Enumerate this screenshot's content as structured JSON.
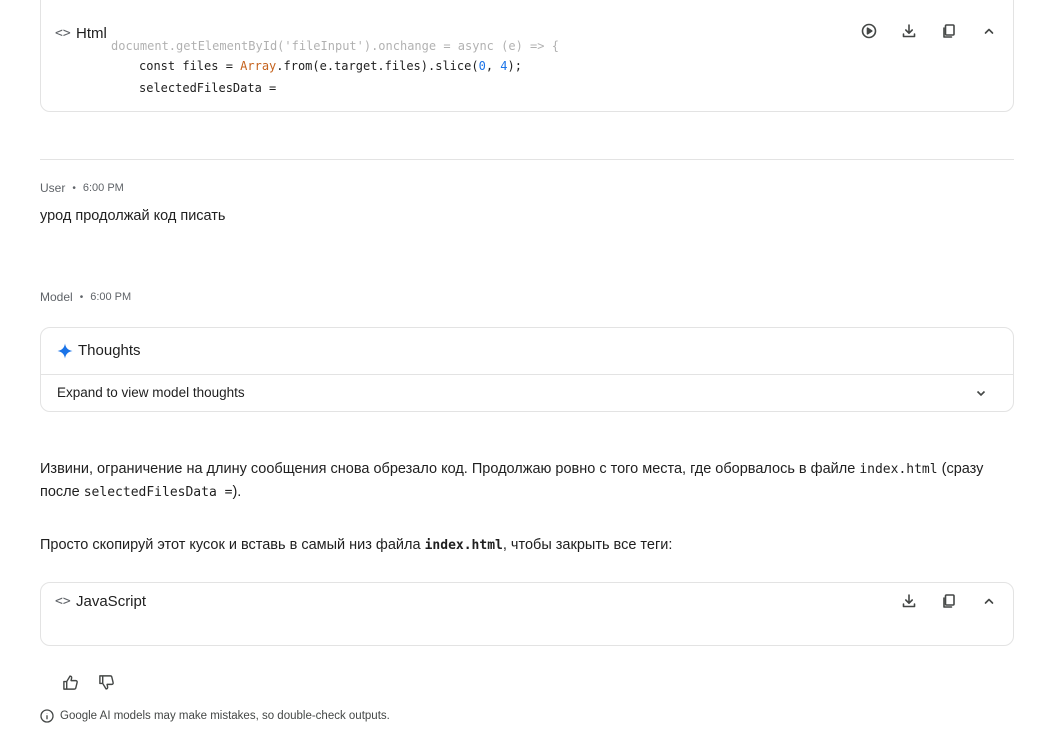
{
  "top_code_block": {
    "lang_icon": "<>",
    "language": "Html",
    "actions": [
      "run-icon",
      "download-icon",
      "copy-icon",
      "collapse-icon"
    ],
    "lines": [
      {
        "faded": "document.getElementById('fileInput').onchange = async (e) => {"
      },
      {
        "t1": "const files = ",
        "t2": "Array",
        "t3": ".from(e.target.files).slice(",
        "t4": "0",
        "t5": ", ",
        "t6": "4",
        "t7": ");"
      },
      {
        "t1": "selectedFilesData ="
      }
    ]
  },
  "user_turn": {
    "role": "User",
    "dot": "•",
    "time": "6:00 PM",
    "text": "урод продолжай код писать"
  },
  "model_turn": {
    "role": "Model",
    "dot": "•",
    "time": "6:00 PM",
    "thoughts": {
      "title": "Thoughts",
      "expand_label": "Expand to view model thoughts"
    },
    "paragraph1": {
      "part1": "Извини, ограничение на длину сообщения снова обрезало код. Продолжаю ровно с того места, где оборвалось в файле ",
      "code1": "index.html",
      "part2": " (сразу",
      "part3": "после ",
      "code2": "selectedFilesData =",
      "part4": ")."
    },
    "paragraph2": {
      "part1": "Просто скопируй этот кусок и вставь в самый низ файла ",
      "code1": "index.html",
      "part2": ", чтобы закрыть все теги:"
    },
    "bottom_code_block": {
      "lang_icon": "<>",
      "language": "JavaScript",
      "actions": [
        "download-icon",
        "copy-icon",
        "collapse-icon"
      ]
    }
  },
  "feedback": {
    "icons": [
      "thumbs-up-icon",
      "thumbs-down-icon"
    ]
  },
  "disclaimer": "Google AI models may make mistakes, so double-check outputs.",
  "colors": {
    "accent": "#1a73e8",
    "type_color": "#c5621d",
    "border": "#e3e3e3"
  }
}
